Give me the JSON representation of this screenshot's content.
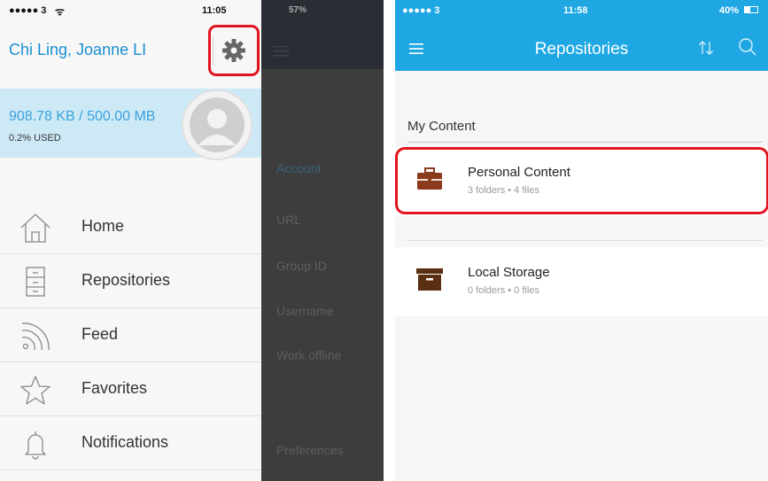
{
  "left_phone": {
    "status": {
      "signal": "●●●●● 3",
      "wifi": "ᯤ",
      "time": "11:05"
    },
    "user_name": "Chi Ling, Joanne LI",
    "storage": {
      "amount": "908.78 KB / 500.00 MB",
      "percent": "0.2% USED"
    },
    "nav": [
      {
        "label": "Home"
      },
      {
        "label": "Repositories"
      },
      {
        "label": "Feed"
      },
      {
        "label": "Favorites"
      },
      {
        "label": "Notifications"
      }
    ],
    "settings_status": "57%",
    "settings": {
      "account": "Account",
      "url": "URL",
      "group_id": "Group ID",
      "username": "Username",
      "work_offline": "Work offline",
      "preferences": "Preferences"
    }
  },
  "right_phone": {
    "status": {
      "signal": "●●●●● 3",
      "time": "11:58",
      "battery": "40%"
    },
    "title": "Repositories",
    "section": "My Content",
    "repositories": [
      {
        "name": "Personal Content",
        "meta": "3 folders • 4 files"
      },
      {
        "name": "Local Storage",
        "meta": "0 folders • 0 files"
      }
    ]
  },
  "colors": {
    "accent_blue": "#1ea7e3",
    "highlight_red": "#e1141f",
    "usage_bg": "#cde9f6",
    "briefcase_brown": "#8b3a1c"
  }
}
